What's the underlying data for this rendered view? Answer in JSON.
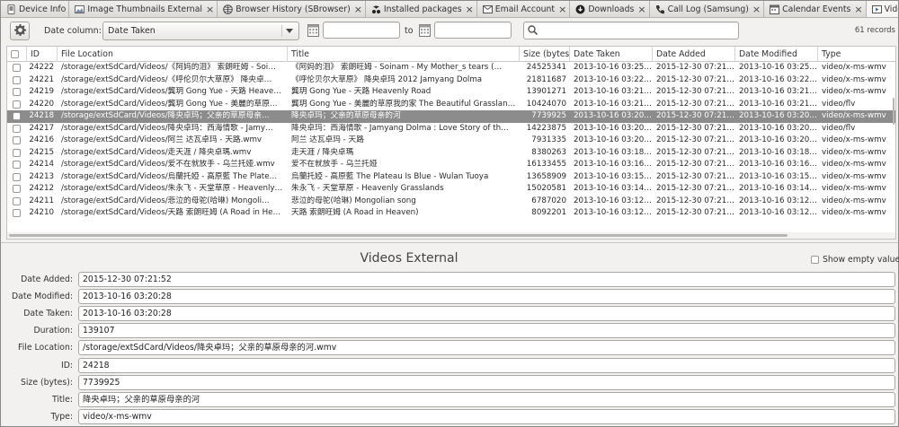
{
  "tabs": [
    {
      "label": "Device Info",
      "icon": "info-icon",
      "closable": false,
      "active": false
    },
    {
      "label": "Image Thumbnails External",
      "icon": "image-icon",
      "closable": true,
      "active": false
    },
    {
      "label": "Browser History (SBrowser)",
      "icon": "globe-icon",
      "closable": true,
      "active": false
    },
    {
      "label": "Installed packages",
      "icon": "package-icon",
      "closable": true,
      "active": false
    },
    {
      "label": "Email Account",
      "icon": "email-icon",
      "closable": true,
      "active": false
    },
    {
      "label": "Downloads",
      "icon": "download-icon",
      "closable": true,
      "active": false
    },
    {
      "label": "Call Log (Samsung)",
      "icon": "phone-icon",
      "closable": true,
      "active": false
    },
    {
      "label": "Calendar Events",
      "icon": "calendar-icon",
      "closable": true,
      "active": false
    },
    {
      "label": "Videos External",
      "icon": "video-icon",
      "closable": true,
      "active": true
    }
  ],
  "toolbar": {
    "date_column_label": "Date column:",
    "date_column_value": "Date Taken",
    "to_label": "to",
    "from_value": "",
    "to_value": "",
    "search_value": "",
    "records": "61 records"
  },
  "table": {
    "columns": [
      "ID",
      "File Location",
      "Title",
      "Size (bytes)",
      "Date Taken",
      "Date Added",
      "Date Modified",
      "Type"
    ],
    "rows": [
      {
        "id": "24222",
        "loc": "/storage/extSdCard/Videos/《阿妈的泪》 索朗旺姆 - Soi…",
        "title": "《阿妈的泪》 索朗旺姆 - Soinam - My Mother_s tears (…",
        "size": "24525341",
        "taken": "2013-10-16 03:25:02",
        "added": "2015-12-30 07:21:52",
        "modified": "2013-10-16 03:25:02",
        "type": "video/x-ms-wmv",
        "selected": false
      },
      {
        "id": "24221",
        "loc": "/storage/extSdCard/Videos/《呼伦贝尔大草原》 降央卓…",
        "title": "《呼伦贝尔大草原》 降央卓玛 2012 Jamyang Dolma",
        "size": "21811687",
        "taken": "2013-10-16 03:22:56",
        "added": "2015-12-30 07:21:52",
        "modified": "2013-10-16 03:22:56",
        "type": "video/x-ms-wmv",
        "selected": false
      },
      {
        "id": "24219",
        "loc": "/storage/extSdCard/Videos/龔玥 Gong Yue - 天路 Heave…",
        "title": "龔玥 Gong Yue - 天路 Heavenly Road",
        "size": "13901271",
        "taken": "2013-10-16 03:21:40",
        "added": "2015-12-30 07:21:52",
        "modified": "2013-10-16 03:21:40",
        "type": "video/x-ms-wmv",
        "selected": false
      },
      {
        "id": "24220",
        "loc": "/storage/extSdCard/Videos/龔玥 Gong Yue - 美麗的草原…",
        "title": "龔玥 Gong Yue - 美麗的草原我的家 The Beautiful Grasslan…",
        "size": "10424070",
        "taken": "2013-10-16 03:21:40",
        "added": "2015-12-30 07:21:52",
        "modified": "2013-10-16 03:21:40",
        "type": "video/flv",
        "selected": false
      },
      {
        "id": "24218",
        "loc": "/storage/extSdCard/Videos/降央卓玛；父亲的草原母亲…",
        "title": "降央卓玛；父亲的草原母亲的河",
        "size": "7739925",
        "taken": "2013-10-16 03:20:28",
        "added": "2015-12-30 07:21:52",
        "modified": "2013-10-16 03:20:28",
        "type": "video/x-ms-wmv",
        "selected": true
      },
      {
        "id": "24217",
        "loc": "/storage/extSdCard/Videos/降央卓玛：西海情歌 - Jamy…",
        "title": "降央卓玛：西海情歌 - Jamyang Dolma : Love Story of th…",
        "size": "14223875",
        "taken": "2013-10-16 03:20:08",
        "added": "2015-12-30 07:21:52",
        "modified": "2013-10-16 03:20:08",
        "type": "video/flv",
        "selected": false
      },
      {
        "id": "24216",
        "loc": "/storage/extSdCard/Videos/阿兰 达瓦卓玛 - 天路.wmv",
        "title": "阿兰 达瓦卓玛 - 天路",
        "size": "7931335",
        "taken": "2013-10-16 03:20:06",
        "added": "2015-12-30 07:21:52",
        "modified": "2013-10-16 03:20:06",
        "type": "video/x-ms-wmv",
        "selected": false
      },
      {
        "id": "24215",
        "loc": "/storage/extSdCard/Videos/走天涯 / 降央卓瑪.wmv",
        "title": "走天涯 / 降央卓瑪",
        "size": "8380263",
        "taken": "2013-10-16 03:18:26",
        "added": "2015-12-30 07:21:52",
        "modified": "2013-10-16 03:18:26",
        "type": "video/x-ms-wmv",
        "selected": false
      },
      {
        "id": "24214",
        "loc": "/storage/extSdCard/Videos/爱不在就放手 - 乌兰托娅.wmv",
        "title": "爱不在就放手 - 乌兰托娅",
        "size": "16133455",
        "taken": "2013-10-16 03:16:40",
        "added": "2015-12-30 07:21:52",
        "modified": "2013-10-16 03:16:40",
        "type": "video/x-ms-wmv",
        "selected": false
      },
      {
        "id": "24213",
        "loc": "/storage/extSdCard/Videos/烏蘭托婭 - 高原藍 The Plate…",
        "title": "烏蘭托婭 - 高原藍 The Plateau Is Blue - Wulan Tuoya",
        "size": "13658909",
        "taken": "2013-10-16 03:15:34",
        "added": "2015-12-30 07:21:52",
        "modified": "2013-10-16 03:15:34",
        "type": "video/x-ms-wmv",
        "selected": false
      },
      {
        "id": "24212",
        "loc": "/storage/extSdCard/Videos/朱永飞 - 天堂草原 - Heavenly…",
        "title": "朱永飞 - 天堂草原 - Heavenly Grasslands",
        "size": "15020581",
        "taken": "2013-10-16 03:14:16",
        "added": "2015-12-30 07:21:52",
        "modified": "2013-10-16 03:14:16",
        "type": "video/x-ms-wmv",
        "selected": false
      },
      {
        "id": "24211",
        "loc": "/storage/extSdCard/Videos/悲泣的母驼(哈琳) Mongoli…",
        "title": "悲泣的母驼(哈琳) Mongolian song",
        "size": "6787020",
        "taken": "2013-10-16 03:12:46",
        "added": "2015-12-30 07:21:52",
        "modified": "2013-10-16 03:12:46",
        "type": "video/x-ms-wmv",
        "selected": false
      },
      {
        "id": "24210",
        "loc": "/storage/extSdCard/Videos/天路 索朗旺姆 (A Road in He…",
        "title": "天路 索朗旺姆 (A Road in Heaven)",
        "size": "8092201",
        "taken": "2013-10-16 03:12:20",
        "added": "2015-12-30 07:21:52",
        "modified": "2013-10-16 03:12:20",
        "type": "video/x-ms-wmv",
        "selected": false
      }
    ]
  },
  "detail": {
    "title": "Videos External",
    "show_empty_label": "Show empty values",
    "fields": [
      {
        "label": "Date Added:",
        "value": "2015-12-30 07:21:52"
      },
      {
        "label": "Date Modified:",
        "value": "2013-10-16 03:20:28"
      },
      {
        "label": "Date Taken:",
        "value": "2013-10-16 03:20:28"
      },
      {
        "label": "Duration:",
        "value": "139107"
      },
      {
        "label": "File Location:",
        "value": "/storage/extSdCard/Videos/降央卓玛；父亲的草原母亲的河.wmv"
      },
      {
        "label": "ID:",
        "value": "24218"
      },
      {
        "label": "Size (bytes):",
        "value": "7739925"
      },
      {
        "label": "Title:",
        "value": "降央卓玛；父亲的草原母亲的河"
      },
      {
        "label": "Type:",
        "value": "video/x-ms-wmv"
      }
    ]
  },
  "colors": {
    "selected_row": "#8c8c8c",
    "accent_icon": "#3f6fa8"
  }
}
